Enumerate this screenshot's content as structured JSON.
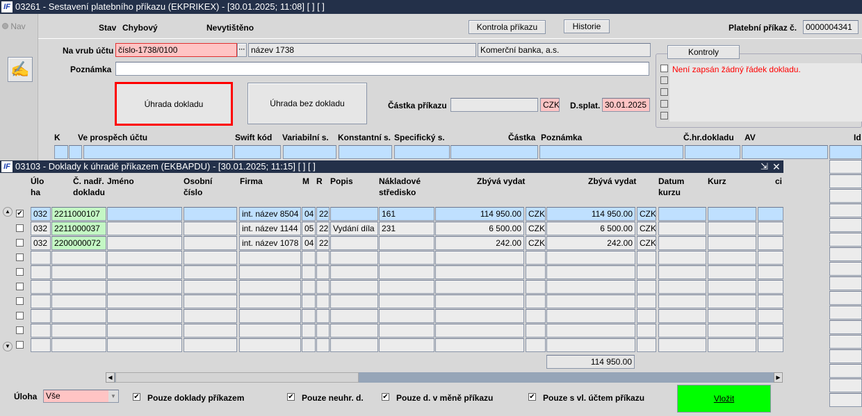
{
  "main": {
    "title": "03261 - Sestavení platebního příkazu (EKPRIKEX) - [30.01.2025; 11:08]  [ ]  [ ]",
    "nav_label": "Nav",
    "stav_label": "Stav",
    "stav_value": "Chybový",
    "tisk_value": "Nevytištěno",
    "kontrola_button": "Kontrola příkazu",
    "historie_button": "Historie",
    "prikaz_label": "Platební příkaz č.",
    "prikaz_value": "0000004341",
    "na_vrub_label": "Na vrub účtu",
    "ucet_value": "číslo-1738/0100",
    "lookup_button": "···",
    "nazev_value": "název 1738",
    "banka_value": "Komerční banka, a.s.",
    "poznamka_label": "Poznámka",
    "poznamka_value": "",
    "uhrada_dokladu_button": "Úhrada dokladu",
    "uhrada_bez_button": "Úhrada bez dokladu",
    "castka_label": "Částka příkazu",
    "castka_value": "",
    "mena_value": "CZK",
    "dsplat_label": "D.splat.",
    "dsplat_value": "30.01.2025",
    "kontroly_tab": "Kontroly",
    "kontroly_message": "Není zapsán žádný řádek dokladu.",
    "grid_headers": [
      "K",
      "Ve prospěch účtu",
      "Swift kód",
      "Variabilní s.",
      "Konstantní s.",
      "Specifický s.",
      "Částka",
      "Poznámka",
      "Č.hr.dokladu",
      "AV",
      "Id"
    ]
  },
  "dialog": {
    "title": "03103 - Doklady k úhradě příkazem (EKBAPDU) - [30.01.2025; 11:15]  [ ]  [ ]",
    "headers": {
      "uloha": "Úlo\nha",
      "cislo": "Č. nadř.\ndokladu",
      "jmeno": "Jméno",
      "osobni": "Osobní\nčíslo",
      "firma": "Firma",
      "m": "M",
      "r": "R",
      "popis": "Popis",
      "naklad": "Nákladové\nstředisko",
      "zbyva1": "Zbývá vydat",
      "zbyva2": "Zbývá vydat",
      "datum": "Datum\nkurzu",
      "kurz": "Kurz",
      "ci": "ci"
    },
    "rows": [
      {
        "checked": true,
        "uloha": "032",
        "cislo": "2211000107",
        "jmeno": "",
        "osobni": "",
        "firma": "int. název 8504",
        "m": "04",
        "r": "22",
        "popis": "",
        "naklad": "161",
        "zbyva1": "114 950.00",
        "mena1": "CZK",
        "zbyva2": "114 950.00",
        "mena2": "CZK"
      },
      {
        "checked": false,
        "uloha": "032",
        "cislo": "2211000037",
        "jmeno": "",
        "osobni": "",
        "firma": "int. název 1144",
        "m": "05",
        "r": "22",
        "popis": "Vydání díla",
        "naklad": "231",
        "zbyva1": "6 500.00",
        "mena1": "CZK",
        "zbyva2": "6 500.00",
        "mena2": "CZK"
      },
      {
        "checked": false,
        "uloha": "032",
        "cislo": "2200000072",
        "jmeno": "",
        "osobni": "",
        "firma": "int. název 1078",
        "m": "04",
        "r": "22",
        "popis": "",
        "naklad": "",
        "zbyva1": "242.00",
        "mena1": "CZK",
        "zbyva2": "242.00",
        "mena2": "CZK"
      }
    ],
    "total": "114 950.00",
    "uloha_label": "Úloha",
    "uloha_value": "Vše",
    "filters": [
      {
        "label": "Pouze doklady příkazem",
        "checked": true
      },
      {
        "label": "Pouze neuhr. d.",
        "checked": true
      },
      {
        "label": "Pouze d. v měně příkazu",
        "checked": true
      },
      {
        "label": "Pouze s vl. účtem příkazu",
        "checked": true
      }
    ],
    "vlozit_button": "Vložit"
  },
  "colors": {
    "title_bar": "#233049",
    "required": "#ffc4c4",
    "selected_row": "#bfe0ff",
    "doc_number": "#c4f7c4",
    "vlozit": "#00ff00",
    "error_text": "#ff0000"
  }
}
